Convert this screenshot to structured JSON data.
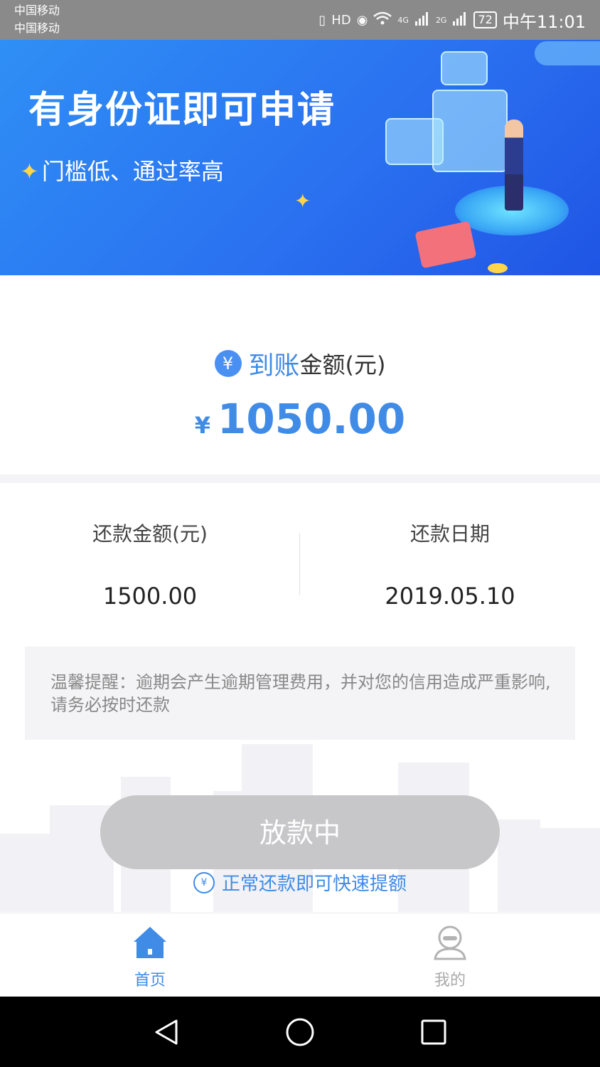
{
  "status_bar": {
    "carrier_1": "中国移动",
    "carrier_2": "中国移动",
    "network_1": "4G",
    "network_2": "2G",
    "hd_badge": "HD",
    "battery": "72",
    "time": "中午11:01"
  },
  "banner": {
    "title": "有身份证即可申请",
    "subtitle": "门槛低、通过率高"
  },
  "received": {
    "label_highlight": "到账",
    "label_rest": "金额(元)",
    "currency": "¥",
    "amount": "1050.00"
  },
  "repayment": {
    "amount_label": "还款金额(元)",
    "amount_value": "1500.00",
    "date_label": "还款日期",
    "date_value": "2019.05.10"
  },
  "notice": {
    "text": "温馨提醒：逾期会产生逾期管理费用，并对您的信用造成严重影响,请务必按时还款"
  },
  "action_button": {
    "label": "放款中"
  },
  "promo": {
    "text": "正常还款即可快速提额"
  },
  "tabbar": {
    "home_label": "首页",
    "me_label": "我的"
  },
  "colors": {
    "accent": "#3f8be6",
    "button_disabled": "#c7c7c9",
    "banner_blue": "#2a6ff0"
  },
  "icons": {
    "vibrate": "vibrate-icon",
    "eye": "eye-icon",
    "wifi": "wifi-icon",
    "signal": "signal-icon",
    "yen": "yen-circle-icon",
    "promo": "yen-up-icon",
    "home": "home-icon",
    "profile": "profile-icon",
    "back": "back-triangle-icon",
    "home_nav": "home-circle-icon",
    "recents": "recents-square-icon"
  }
}
